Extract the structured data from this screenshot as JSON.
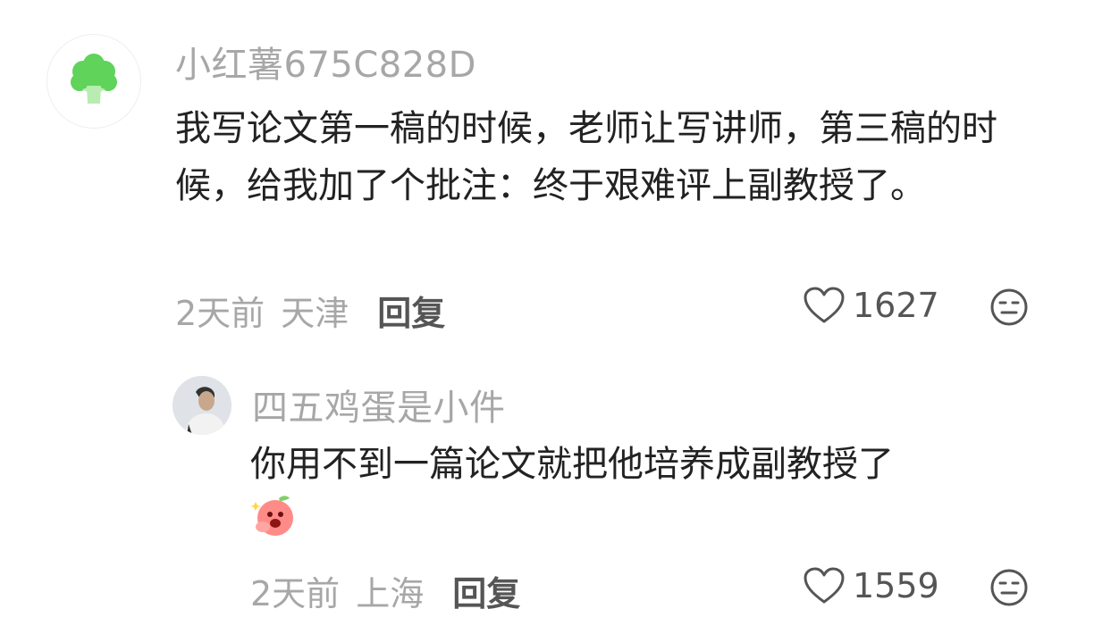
{
  "comments": [
    {
      "username": "小红薯675C828D",
      "content": "我写论文第一稿的时候，老师让写讲师，第三稿的时候，给我加了个批注：终于艰难评上副教授了。",
      "time": "2天前",
      "location": "天津",
      "reply_label": "回复",
      "likes": "1627",
      "avatar_icon": "broccoli-icon"
    },
    {
      "username": "四五鸡蛋是小件",
      "content": "你用不到一篇论文就把他培养成副教授了",
      "sticker_icon": "peach-cheer-sticker-icon",
      "time": "2天前",
      "location": "上海",
      "reply_label": "回复",
      "likes": "1559",
      "avatar_icon": "user-photo-avatar"
    }
  ],
  "colors": {
    "username": "#a7a7a7",
    "content": "#222222",
    "meta": "#a7a7a7",
    "action": "#555555",
    "avatar_green": "#5fd35a"
  }
}
